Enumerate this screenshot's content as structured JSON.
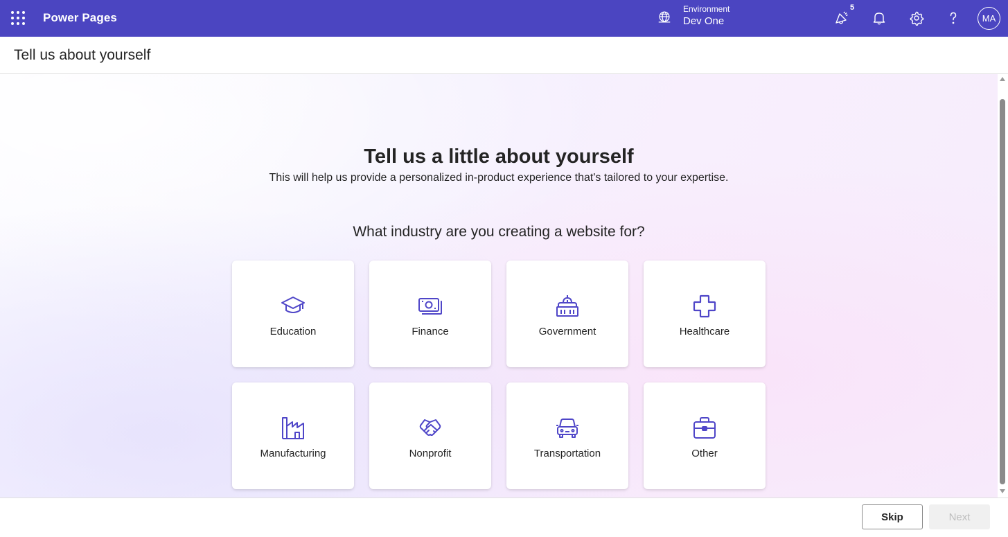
{
  "app": {
    "title": "Power Pages",
    "environment_label": "Environment",
    "environment_value": "Dev One",
    "notification_badge": "5",
    "avatar_initials": "MA",
    "bar_color": "#4b45c1"
  },
  "page": {
    "title": "Tell us about yourself"
  },
  "main": {
    "heading": "Tell us a little about yourself",
    "subheading": "This will help us provide a personalized in-product experience that's tailored to your expertise.",
    "question": "What industry are you creating a website for?",
    "accent_color": "#4f46c8",
    "industries": [
      {
        "label": "Education",
        "icon": "graduation-cap-icon"
      },
      {
        "label": "Finance",
        "icon": "money-icon"
      },
      {
        "label": "Government",
        "icon": "government-building-icon"
      },
      {
        "label": "Healthcare",
        "icon": "medical-cross-icon"
      },
      {
        "label": "Manufacturing",
        "icon": "factory-icon"
      },
      {
        "label": "Nonprofit",
        "icon": "handshake-icon"
      },
      {
        "label": "Transportation",
        "icon": "car-icon"
      },
      {
        "label": "Other",
        "icon": "briefcase-icon"
      }
    ]
  },
  "footer": {
    "skip_label": "Skip",
    "next_label": "Next"
  }
}
